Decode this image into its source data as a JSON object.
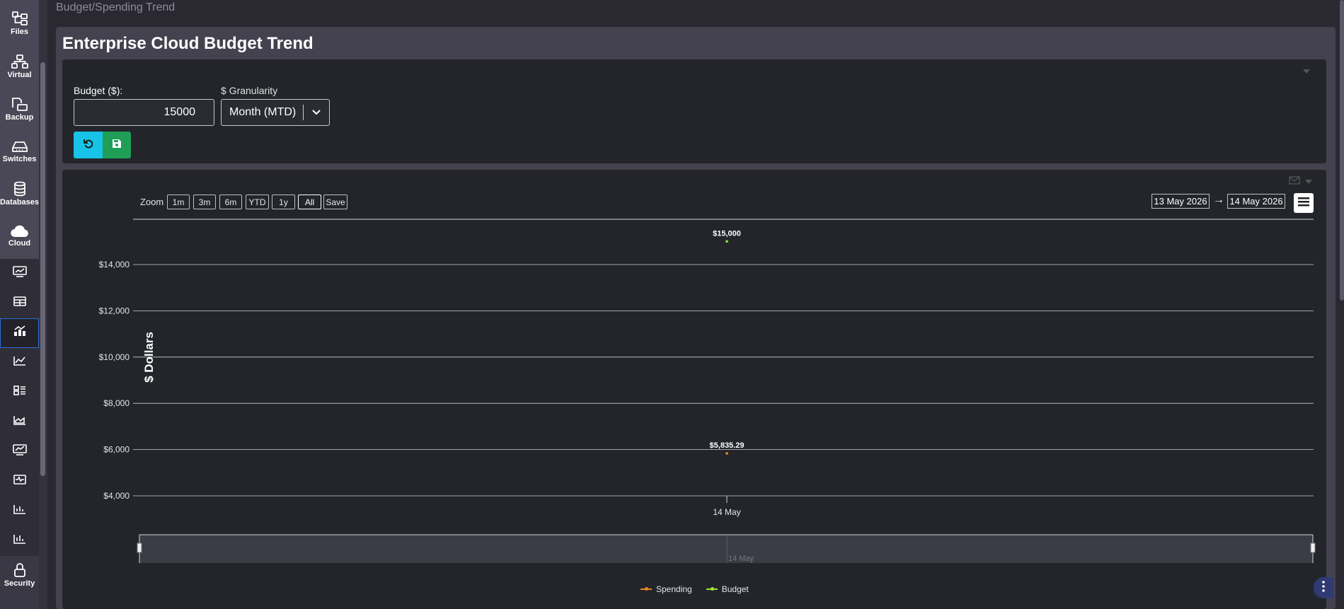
{
  "sidebar": {
    "items": [
      {
        "label": "Files",
        "icon": "files-icon"
      },
      {
        "label": "Virtual",
        "icon": "network-icon"
      },
      {
        "label": "Backup",
        "icon": "backup-icon"
      },
      {
        "label": "Switches",
        "icon": "switch-icon"
      },
      {
        "label": "Databases",
        "icon": "database-icon"
      },
      {
        "label": "Cloud",
        "icon": "cloud-icon"
      }
    ],
    "sub_items": [
      "money-trend-icon",
      "table-icon",
      "budget-chart-icon",
      "line-chart-icon",
      "dashboard-grid-icon",
      "area-chart-icon",
      "money-chart-icon",
      "monitor-wave-icon",
      "bar-chart-icon",
      "bar-chart-alt-icon"
    ],
    "bottom_item": {
      "label": "Security",
      "icon": "lock-icon"
    }
  },
  "breadcrumb": "Budget/Spending Trend",
  "page_title": "Enterprise Cloud Budget Trend",
  "form": {
    "budget_label": "Budget ($):",
    "budget_value": "15000",
    "granularity_label": "$ Granularity",
    "granularity_value": "Month (MTD)"
  },
  "toolbar": {
    "zoom_label": "Zoom",
    "zoom_buttons": [
      "1m",
      "3m",
      "6m",
      "YTD",
      "1y",
      "All",
      "Save"
    ],
    "selected_zoom": "All",
    "date_from": "13 May 2026",
    "date_arrow": "→",
    "date_to": "14 May 2026"
  },
  "colors": {
    "spending": "#e8891c",
    "budget": "#9ee83a",
    "accent_reset": "#17c3e6",
    "accent_save": "#1f9e58"
  },
  "chart_data": {
    "type": "line",
    "ylabel": "$ Dollars",
    "ylim": [
      3000,
      15500
    ],
    "yticks": [
      4000,
      6000,
      8000,
      10000,
      12000,
      14000
    ],
    "ytick_labels": [
      "$4,000",
      "$6,000",
      "$8,000",
      "$10,000",
      "$12,000",
      "$14,000"
    ],
    "x_labels": [
      "14 May"
    ],
    "navigator_label": "14 May",
    "legend_position": "bottom-center",
    "grid": true,
    "series": [
      {
        "name": "Spending",
        "x": [
          "14 May"
        ],
        "values": [
          5835.29
        ],
        "data_label": "$5,835.29"
      },
      {
        "name": "Budget",
        "x": [
          "14 May"
        ],
        "values": [
          15000
        ],
        "data_label": "$15,000"
      }
    ]
  }
}
